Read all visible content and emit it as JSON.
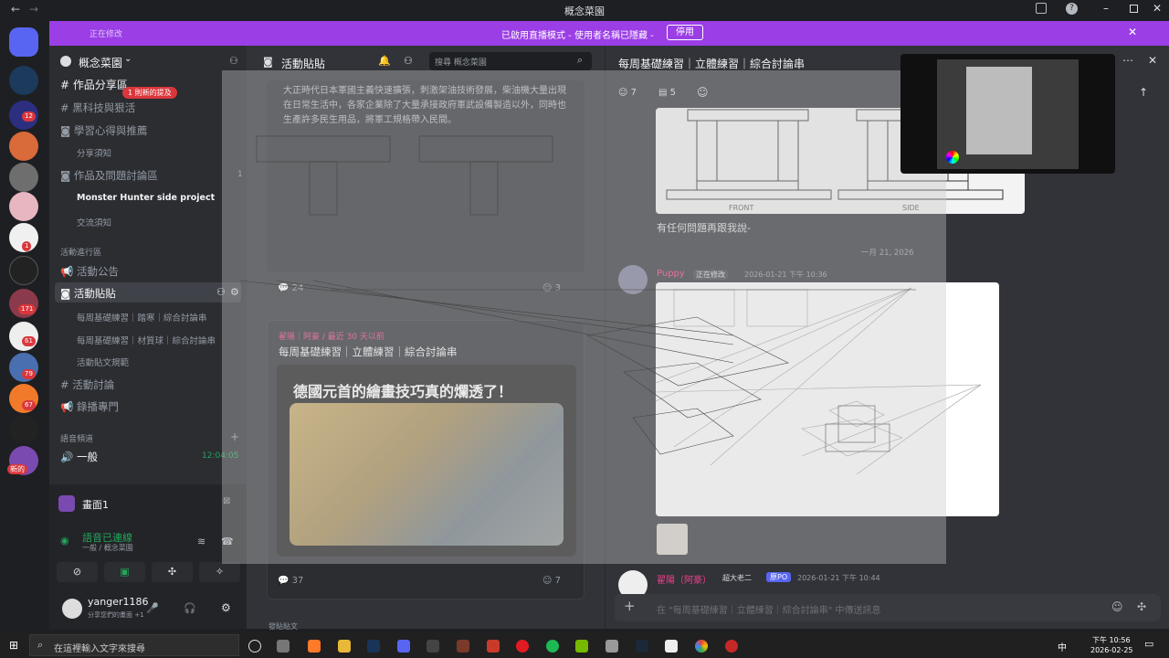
{
  "window": {
    "title": "概念菜園"
  },
  "banner": {
    "text": "已啟用直播模式 - 使用者名稱已隱藏 -",
    "button": "停用",
    "left_text": "正在修改"
  },
  "guilds": {
    "badges": [
      "12",
      "1",
      "171",
      "61",
      "79",
      "67",
      "新的"
    ]
  },
  "server": {
    "name": "概念菜園"
  },
  "channels": [
    {
      "label": "作品分享區",
      "badge": "1 則新的提及"
    },
    {
      "label": "黑科技與狠活"
    },
    {
      "label": "學習心得與推薦"
    },
    {
      "label": "分享須知"
    },
    {
      "label": "作品及問題討論區"
    },
    {
      "label": "Monster Hunter side project"
    },
    {
      "label": "交流須知"
    },
    {
      "label": "活動進行區"
    },
    {
      "label": "活動公告"
    },
    {
      "label": "活動貼貼"
    },
    {
      "label": "每周基礎練習｜踏寒｜綜合討論串"
    },
    {
      "label": "每周基礎練習｜材質球｜綜合討論串"
    },
    {
      "label": "活動貼文規範"
    },
    {
      "label": "活動討論"
    },
    {
      "label": "錄播專門"
    },
    {
      "label": "語音頻道"
    },
    {
      "label": "一般",
      "time": "12:04:05"
    }
  ],
  "voice": {
    "screen_label": "畫面1",
    "status": "語音已連線",
    "sub": "一般 / 概念菜園"
  },
  "user": {
    "name": "yanger1186",
    "status": "分享您們的畫面 +1"
  },
  "list": {
    "header": "活動貼貼",
    "search_placeholder": "搜尋 概念菜園",
    "post1_text": "大正時代日本軍國主義快速擴張，刺激架油技術發展，柴油機大量出現在日常生活中，各家企業除了大量承接政府軍武設備製造以外，同時也生產許多民生用品，將軍工規格帶入民間。",
    "post1_replies": "24",
    "post1_reacts": "3",
    "post1_side": "1",
    "post2_author": "翟陽｜阿豪 / 最近 30 天以前",
    "post2_title": "每周基礎練習｜立體練習｜綜合討論串",
    "post2_image_caption": "德國元首的繪畫技巧真的爛透了！",
    "post2_replies": "37",
    "post2_reacts": "7",
    "footer": "發貼貼文"
  },
  "thread": {
    "title": "每周基礎練習｜立體練習｜綜合討論串",
    "react1": "7",
    "react2": "5",
    "msg1": "有任何問題再跟我說-",
    "date": "一月 21, 2026",
    "author": "Puppy",
    "author_tag": "正在修改",
    "timestamp": "2026-01-21 下午 10:36",
    "drawing_labels": [
      "FRONT",
      "SIDE"
    ],
    "next_author": "翟陽（阿豪）",
    "next_tag": "超大老二",
    "next_badge": "原PO",
    "next_time": "2026-01-21 下午 10:44",
    "input_placeholder": "在 \"每周基礎練習｜立體練習｜綜合討論串\" 中傳送訊息"
  },
  "taskbar": {
    "search": "在這裡輸入文字來搜尋",
    "time": "下午 10:56",
    "date": "2026-02-25",
    "ime": "中"
  }
}
